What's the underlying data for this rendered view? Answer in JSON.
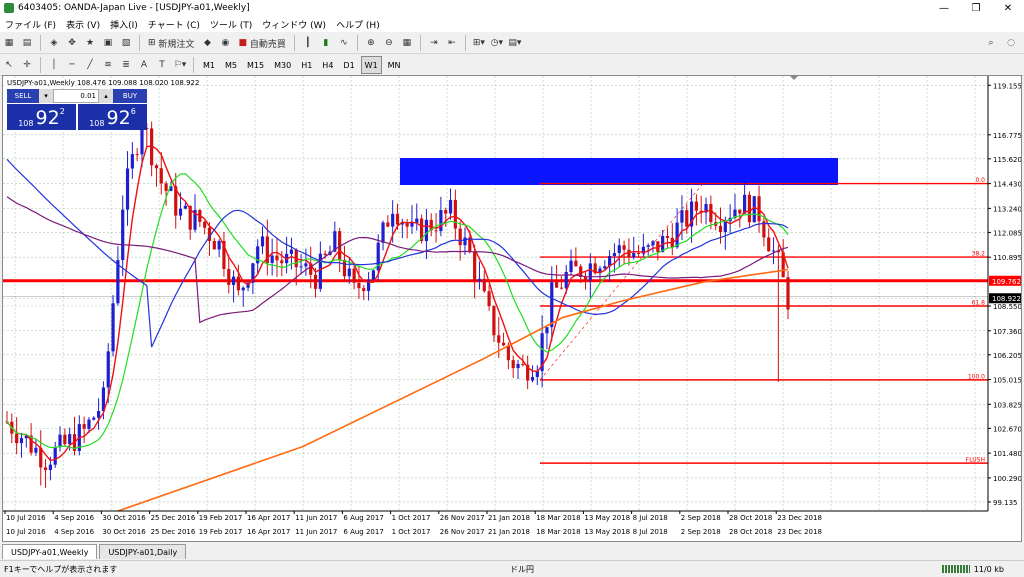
{
  "window": {
    "title": "6403405: OANDA-Japan Live - [USDJPY-a01,Weekly]",
    "controls": [
      "—",
      "❐",
      "✕"
    ]
  },
  "menu": [
    "ファイル (F)",
    "表示 (V)",
    "挿入(I)",
    "チャート (C)",
    "ツール (T)",
    "ウィンドウ (W)",
    "ヘルプ (H)"
  ],
  "toolbar": {
    "new_order": "新規注文",
    "auto_trade": "自動売買",
    "timeframes": [
      "M1",
      "M5",
      "M15",
      "M30",
      "H1",
      "H4",
      "D1",
      "W1",
      "MN"
    ],
    "active_timeframe": "W1"
  },
  "chart": {
    "header": "USDJPY-a01,Weekly  108.476 109.088 108.020 108.922",
    "trade_panel": {
      "sell_label": "SELL",
      "buy_label": "BUY",
      "lot": "0.01",
      "sell_big": "108",
      "sell_price": "92",
      "sell_sup": "2",
      "buy_big": "108",
      "buy_price": "92",
      "buy_sup": "6"
    },
    "price_labels": [
      "119.155",
      "116.775",
      "115.620",
      "114.430",
      "113.240",
      "112.085",
      "110.895",
      "109.762",
      "108.922",
      "108.550",
      "107.360",
      "106.205",
      "105.015",
      "103.825",
      "102.670",
      "101.480",
      "100.290",
      "99.135"
    ],
    "fib_labels": [
      "0.0",
      "38.2",
      "61.8",
      "100.0",
      "FLUSH"
    ],
    "date_labels": [
      "10 Jul 2016",
      "4 Sep 2016",
      "30 Oct 2016",
      "25 Dec 2016",
      "19 Feb 2017",
      "16 Apr 2017",
      "11 Jun 2017",
      "6 Aug 2017",
      "1 Oct 2017",
      "26 Nov 2017",
      "21 Jan 2018",
      "18 Mar 2018",
      "13 May 2018",
      "8 Jul 2018",
      "2 Sep 2018",
      "28 Oct 2018",
      "23 Dec 2018"
    ],
    "colors": {
      "grid": "#a8c8a8",
      "bull": "#1f1fd0",
      "bear": "#d01010",
      "ma_red": "#ee1111",
      "ma_green": "#22dd22",
      "ma_blue": "#2233dd",
      "ma_purple": "#7a1a7a",
      "ma_orange": "#ff6a10",
      "hline": "#ff0000",
      "zone": "#0a14ff"
    }
  },
  "tabs": [
    "USDJPY-a01,Weekly",
    "USDJPY-a01,Daily"
  ],
  "status": {
    "hint": "F1キーでヘルプが表示されます",
    "symbol": "ドル円",
    "traffic": "11/0 kb"
  }
}
